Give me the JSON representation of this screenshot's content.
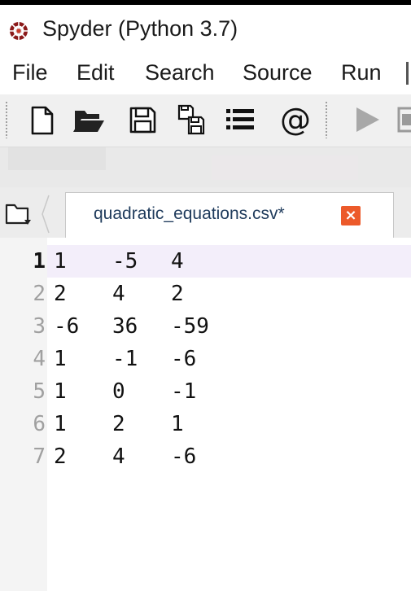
{
  "window": {
    "title": "Spyder (Python 3.7)"
  },
  "menu": {
    "items": [
      "File",
      "Edit",
      "Search",
      "Source",
      "Run"
    ]
  },
  "toolbar": {
    "buttons": [
      {
        "name": "new-file-icon"
      },
      {
        "name": "open-file-icon"
      },
      {
        "name": "save-icon"
      },
      {
        "name": "save-all-icon"
      },
      {
        "name": "list-icon"
      },
      {
        "name": "at-icon",
        "glyph": "@"
      },
      {
        "name": "run-icon"
      }
    ]
  },
  "editor": {
    "tab": {
      "label": "quadratic_equations.csv*"
    },
    "current_line": 1,
    "lines": [
      {
        "no": "1",
        "cols": [
          "1",
          "-5",
          "4"
        ]
      },
      {
        "no": "2",
        "cols": [
          "2",
          "4",
          "2"
        ]
      },
      {
        "no": "3",
        "cols": [
          "-6",
          "36",
          "-59"
        ]
      },
      {
        "no": "4",
        "cols": [
          "1",
          "-1",
          "-6"
        ]
      },
      {
        "no": "5",
        "cols": [
          "1",
          "0",
          "-1"
        ]
      },
      {
        "no": "6",
        "cols": [
          "1",
          "2",
          "1"
        ]
      },
      {
        "no": "7",
        "cols": [
          "2",
          "4",
          "-6"
        ]
      }
    ]
  },
  "colors": {
    "tab_close": "#ec5a2a",
    "current_line": "#f3eefa"
  }
}
